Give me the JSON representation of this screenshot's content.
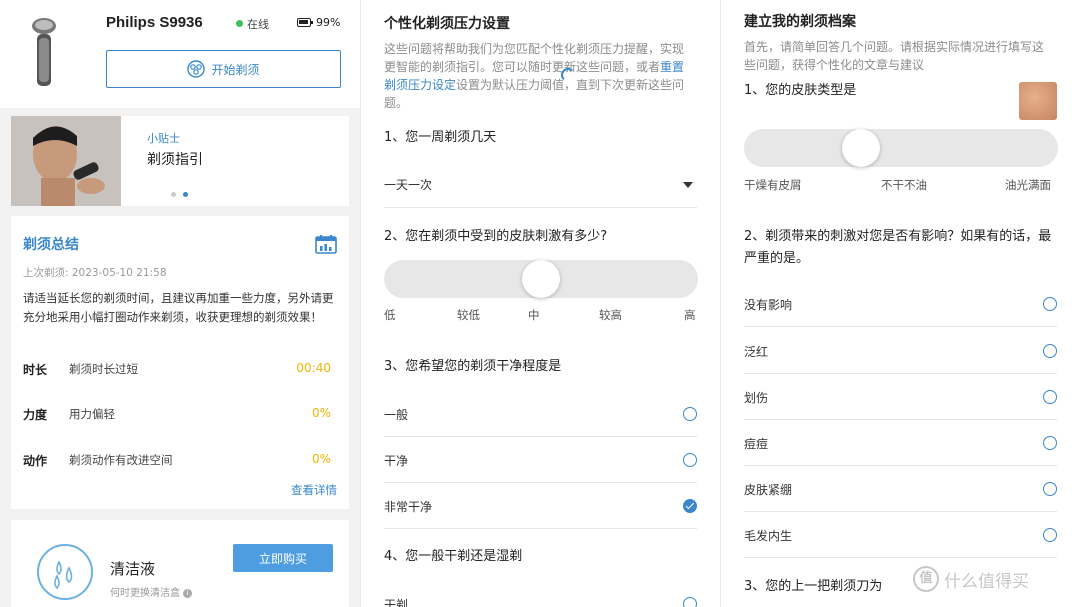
{
  "panel1": {
    "device_name": "Philips S9936",
    "status": "在线",
    "battery": "99%",
    "start_button": "开始剃须",
    "tip": {
      "tag": "小贴士",
      "title": "剃须指引"
    },
    "summary": {
      "title": "剃须总结",
      "last_shave": "上次剃须: 2023-05-10 21:58",
      "advice": "请适当延长您的剃须时间，且建议再加重一些力度，另外请更充分地采用小幅打圈动作来剃须，收获更理想的剃须效果！",
      "rows": [
        {
          "key": "时长",
          "desc": "剃须时长过短",
          "value": "00:40"
        },
        {
          "key": "力度",
          "desc": "用力偏轻",
          "value": "0%"
        },
        {
          "key": "动作",
          "desc": "剃须动作有改进空间",
          "value": "0%"
        }
      ],
      "details_link": "查看详情"
    },
    "cleaning": {
      "title": "清洁液",
      "subtitle": "何时更换清洁盒",
      "buy_button": "立即购买"
    }
  },
  "panel2": {
    "title": "个性化剃须压力设置",
    "desc_part1": "这些问题将帮助我们为您匹配个性化剃须压力提醒，实现更智能的剃须指引。您可以随时更新这些问题，或者",
    "desc_link": "重置剃须压力设定",
    "desc_part2": "设置为默认压力阈值，直到下次更新这些问题。",
    "q1": "1、您一周剃须几天",
    "q1_value": "一天一次",
    "q2": "2、您在剃须中受到的皮肤刺激有多少?",
    "q2_labels": [
      "低",
      "较低",
      "中",
      "较高",
      "高"
    ],
    "q2_value_index": 2,
    "q3": "3、您希望您的剃须干净程度是",
    "q3_options": [
      {
        "label": "一般",
        "selected": false
      },
      {
        "label": "干净",
        "selected": false
      },
      {
        "label": "非常干净",
        "selected": true
      }
    ],
    "q4": "4、您一般干剃还是湿剃",
    "q4_first_option": "干剃"
  },
  "panel3": {
    "title": "建立我的剃须档案",
    "desc": "首先，请简单回答几个问题。请根据实际情况进行填写这些问题，获得个性化的文章与建议",
    "q1": "1、您的皮肤类型是",
    "q1_labels": [
      "干燥有皮屑",
      "不干不油",
      "油光满面"
    ],
    "q1_value_index": 1,
    "q2": "2、剃须带来的刺激对您是否有影响？如果有的话，最严重的是。",
    "q2_options": [
      {
        "label": "没有影响",
        "selected": false
      },
      {
        "label": "泛红",
        "selected": false
      },
      {
        "label": "划伤",
        "selected": false
      },
      {
        "label": "痘痘",
        "selected": false
      },
      {
        "label": "皮肤紧绷",
        "selected": false
      },
      {
        "label": "毛发内生",
        "selected": false
      }
    ],
    "q3": "3、您的上一把剃须刀为",
    "watermark": "什么值得买",
    "watermark_logo": "值"
  },
  "colors": {
    "accent": "#3a87cc",
    "value_yellow": "#f5b400",
    "online_green": "#3dc05a",
    "buy_button": "#4e9de0"
  }
}
